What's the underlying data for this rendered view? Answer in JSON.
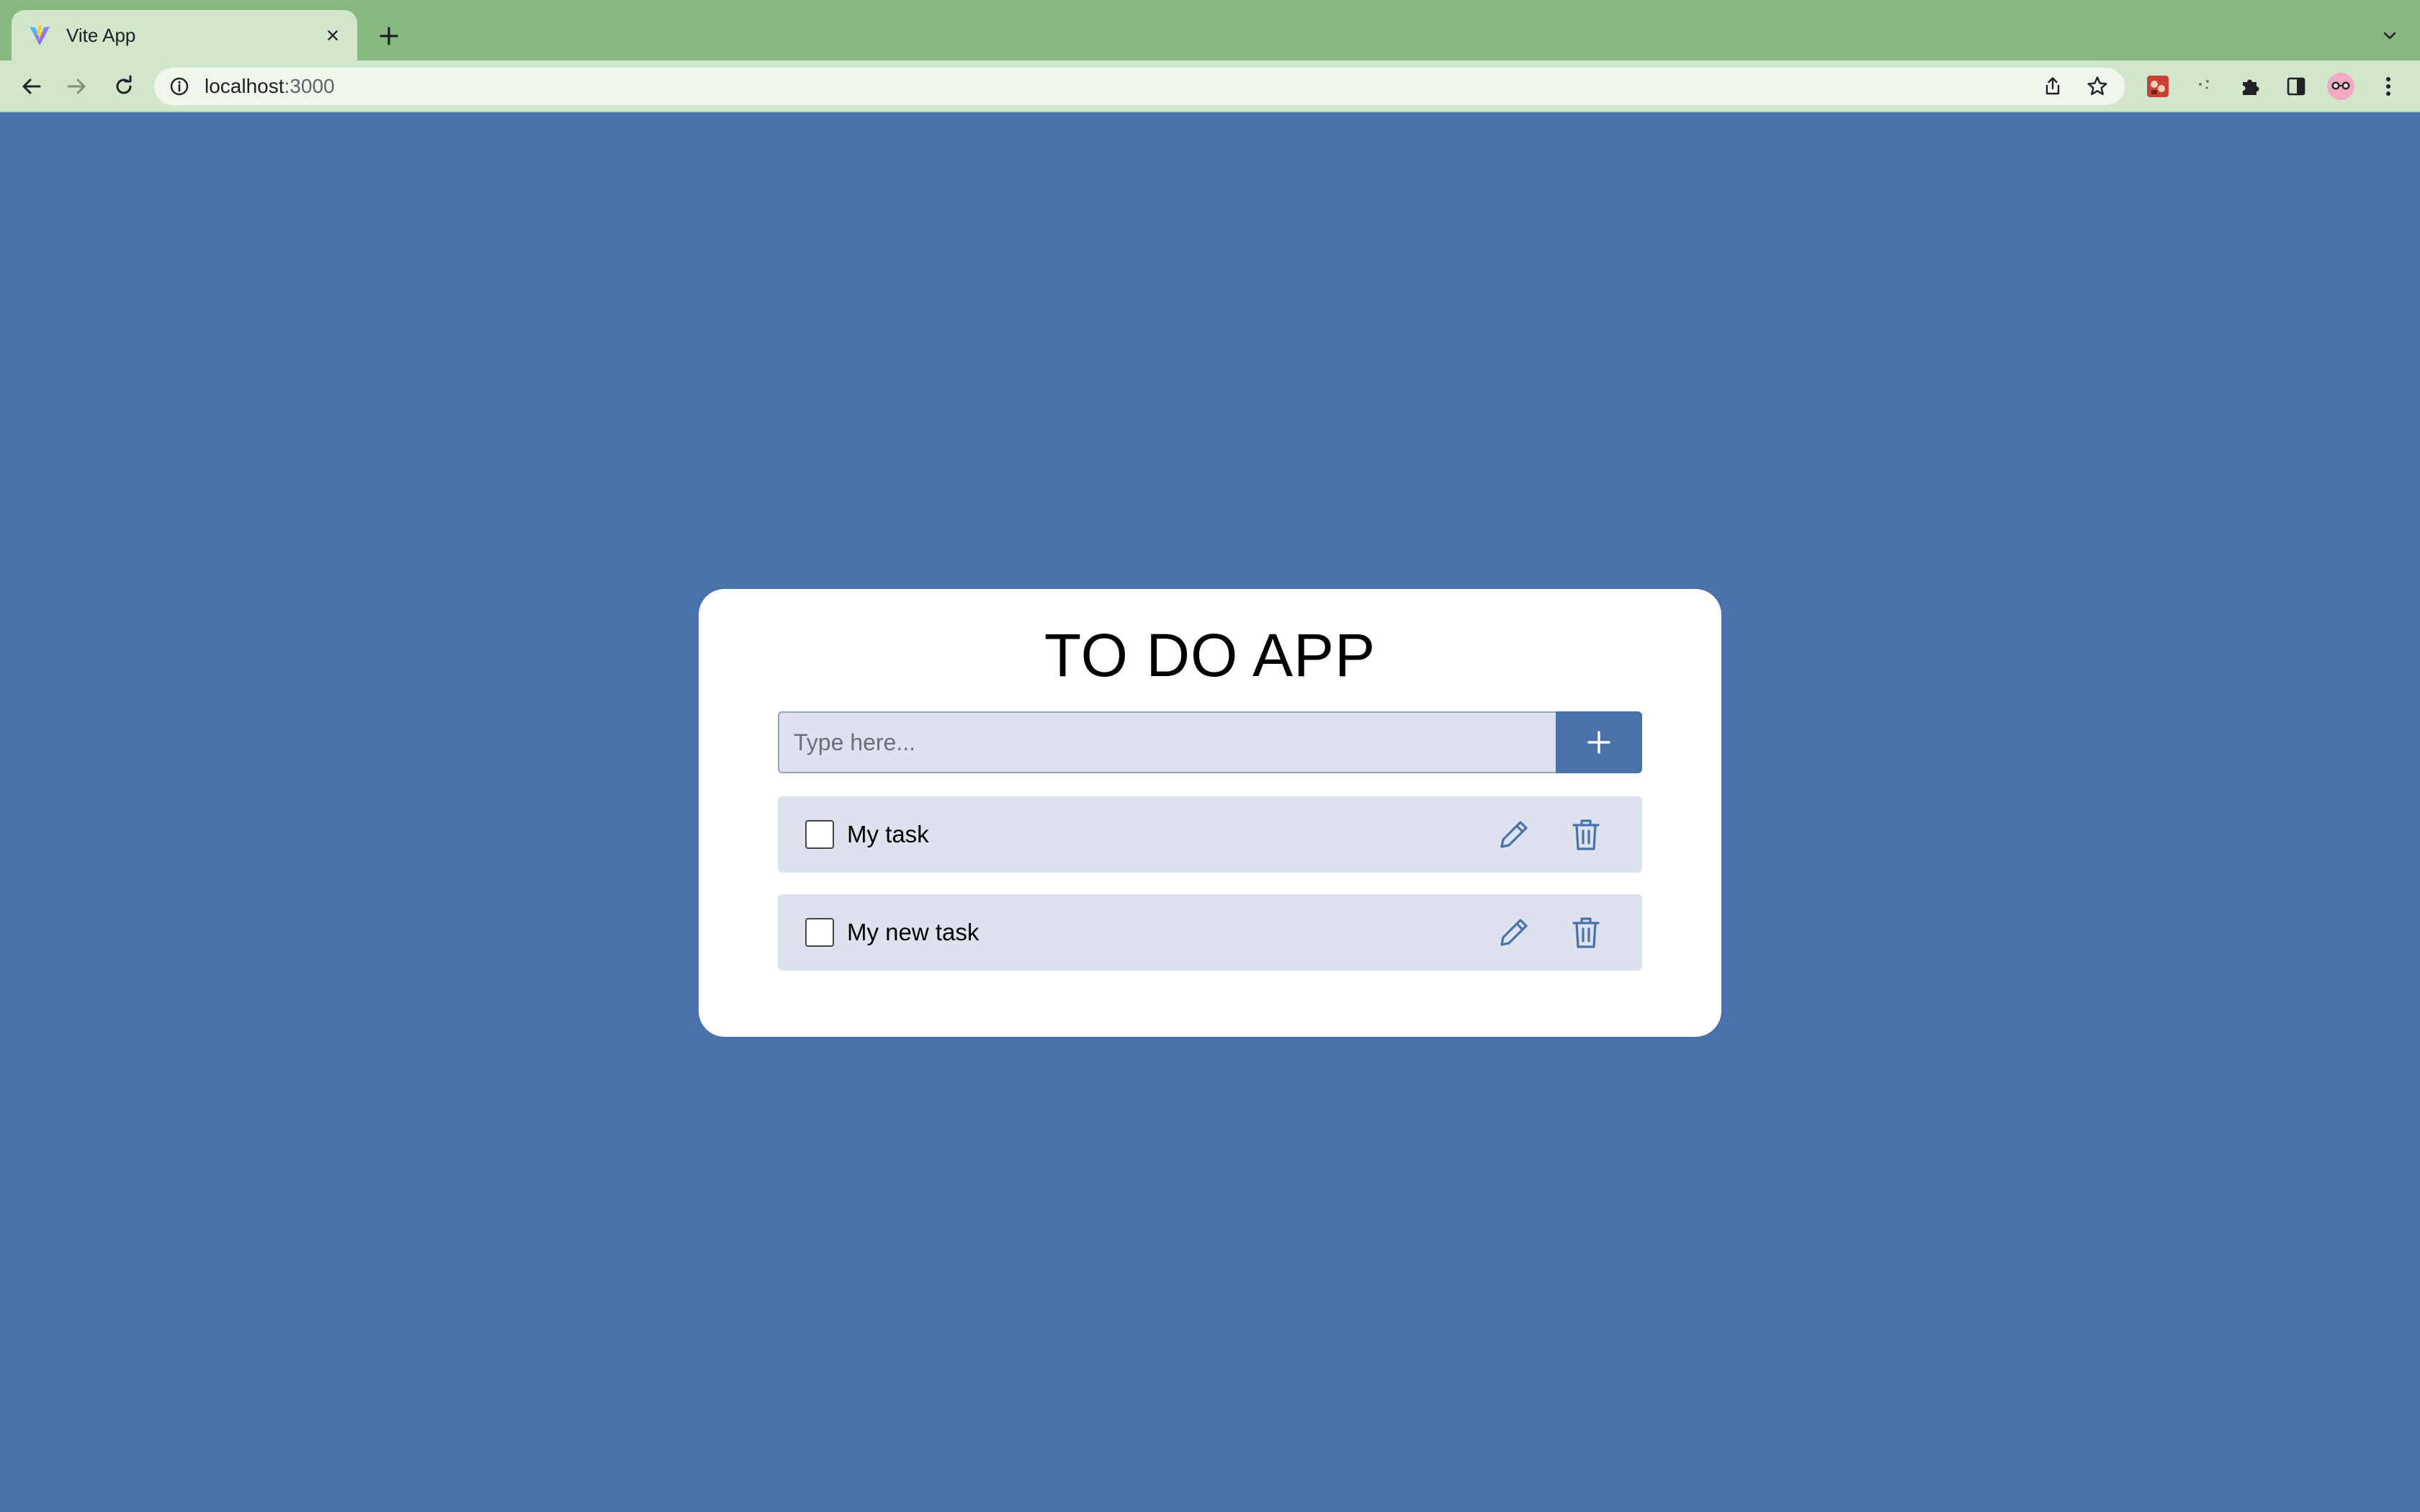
{
  "browser": {
    "tab": {
      "title": "Vite App",
      "close_glyph": "×",
      "favicon": "vite-logo-icon"
    },
    "new_tab_icon": "plus-icon",
    "tab_list_icon": "chevron-down-icon",
    "nav": {
      "back_icon": "arrow-left-icon",
      "forward_icon": "arrow-right-icon",
      "reload_icon": "reload-icon"
    },
    "address": {
      "host": "localhost",
      "port": ":3000",
      "info_icon": "info-icon"
    },
    "omnibox_actions": [
      "share-icon",
      "star-icon"
    ],
    "extensions": [
      "extension-red-icon",
      "extension-sparkle-icon",
      "puzzle-icon",
      "side-panel-icon",
      "profile-avatar-icon",
      "kebab-menu-icon"
    ]
  },
  "colors": {
    "tabstrip": "#86b880",
    "toolbar": "#d1e6cb",
    "page_background": "#4a72aa",
    "card": "#ffffff",
    "item_background": "#dde2ee",
    "accent": "#4a72aa"
  },
  "app": {
    "title": "TO DO APP",
    "input": {
      "value": "",
      "placeholder": "Type here..."
    },
    "add_button_icon": "plus-icon",
    "tasks": [
      {
        "label": "My task",
        "checked": false,
        "edit_icon": "pencil-icon",
        "delete_icon": "trash-icon"
      },
      {
        "label": "My new task",
        "checked": false,
        "edit_icon": "pencil-icon",
        "delete_icon": "trash-icon"
      }
    ]
  }
}
